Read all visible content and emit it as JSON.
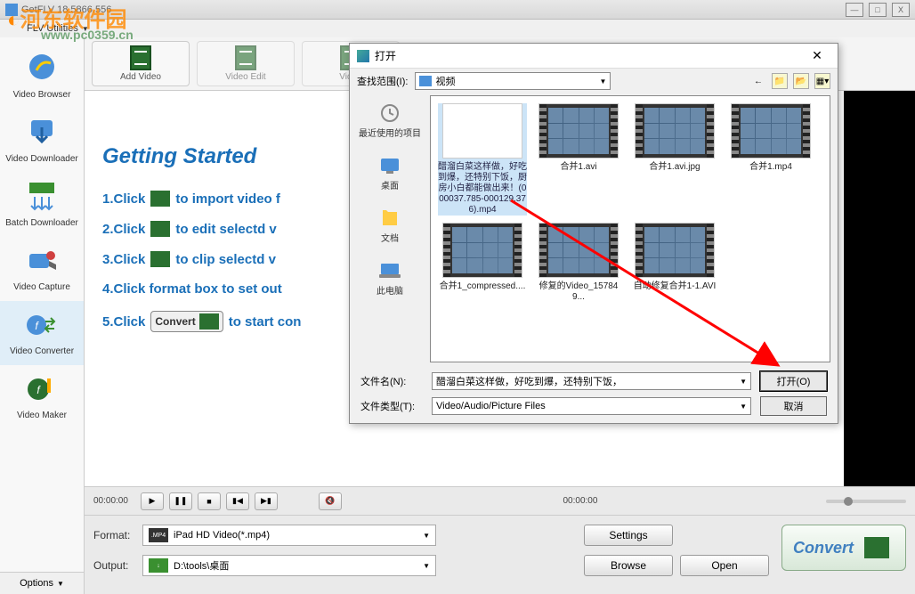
{
  "window": {
    "title": "GetFLV 18.5866.556"
  },
  "watermark": {
    "brand": "河东软件园",
    "url": "www.pc0359.cn"
  },
  "menubar": {
    "item1": "FLV Utilities"
  },
  "win_controls": {
    "min": "—",
    "max": "□",
    "close": "X"
  },
  "sidebar": {
    "items": [
      {
        "label": "Video Browser"
      },
      {
        "label": "Video Downloader"
      },
      {
        "label": "Batch Downloader"
      },
      {
        "label": "Video Capture"
      },
      {
        "label": "Video Converter"
      },
      {
        "label": "Video Maker"
      }
    ],
    "options": "Options"
  },
  "toolbar": {
    "add_video": "Add Video",
    "video_edit": "Video Edit",
    "video_clip": "Video"
  },
  "getting_started": {
    "title": "Getting Started",
    "step1_a": "1.Click",
    "step1_b": "to import video f",
    "step2_a": "2.Click",
    "step2_b": "to edit selectd v",
    "step3_a": "3.Click",
    "step3_b": "to clip selectd v",
    "step4": "4.Click format box to set out",
    "step5_a": "5.Click",
    "step5_badge": "Convert",
    "step5_b": "to start con"
  },
  "player": {
    "time_start": "00:00:00",
    "time_end": "00:00:00"
  },
  "bottom": {
    "format_label": "Format:",
    "format_value": "iPad HD Video(*.mp4)",
    "format_icon": ".MP4",
    "output_label": "Output:",
    "output_value": "D:\\tools\\桌面",
    "settings_btn": "Settings",
    "browse_btn": "Browse",
    "open_btn": "Open",
    "convert_btn": "Convert"
  },
  "file_dialog": {
    "title": "打开",
    "lookin_label": "查找范围(I):",
    "lookin_value": "视频",
    "places": [
      {
        "label": "最近使用的项目"
      },
      {
        "label": "桌面"
      },
      {
        "label": "文档"
      },
      {
        "label": "此电脑"
      }
    ],
    "files": [
      {
        "name": "醋溜白菜这样做，好吃到爆，还特别下饭，厨房小白都能做出来！(000037.785-000129.376).mp4",
        "type": "doc",
        "selected": true
      },
      {
        "name": "合并1.avi",
        "type": "vid"
      },
      {
        "name": "合并1.avi.jpg",
        "type": "vid"
      },
      {
        "name": "合并1.mp4",
        "type": "vid"
      },
      {
        "name": "合并1_compressed....",
        "type": "vid"
      },
      {
        "name": "修复的Video_157849...",
        "type": "vid"
      },
      {
        "name": "自动修复合并1-1.AVI",
        "type": "vid"
      }
    ],
    "filename_label": "文件名(N):",
    "filename_value": "醋溜白菜这样做，好吃到爆，还特别下饭，",
    "filetype_label": "文件类型(T):",
    "filetype_value": "Video/Audio/Picture Files",
    "open_btn": "打开(O)",
    "cancel_btn": "取消"
  }
}
